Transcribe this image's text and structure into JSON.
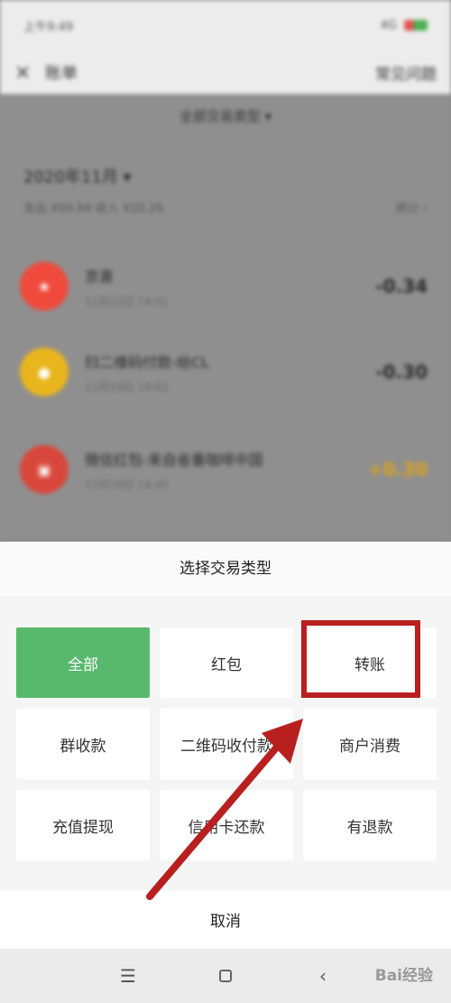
{
  "status_bar": {
    "time": "上午9:49",
    "signal": "4G"
  },
  "nav": {
    "close_icon": "×",
    "title": "账单",
    "help_label": "常见问题"
  },
  "filter": {
    "label": "全部交易类型 ▾"
  },
  "month": {
    "label": "2020年11月 ▾",
    "summary": "支出 ¥99.94 收入 ¥20.26",
    "stats_label": "统计 ›"
  },
  "transactions": [
    {
      "name": "京喜",
      "time": "11月22日 14:01",
      "amount": "-0.34",
      "icon_color": "#f04a3c",
      "icon": "store-icon"
    },
    {
      "name": "扫二维码付款-给CL",
      "time": "11月19日 19:02",
      "amount": "-0.30",
      "icon_color": "#e8b51e",
      "icon": "qr-pay-icon"
    },
    {
      "name": "微信红包-来自省番咖啡中国",
      "time": "11月19日 14:45",
      "amount": "+0.30",
      "icon_color": "#d9473c",
      "icon": "red-packet-icon"
    }
  ],
  "sheet": {
    "title": "选择交易类型",
    "options": [
      "全部",
      "红包",
      "转账",
      "群收款",
      "二维码收付款",
      "商户消费",
      "充值提现",
      "信用卡还款",
      "有退款"
    ],
    "selected": "全部",
    "cancel_label": "取消"
  },
  "system_nav": {
    "menu_icon": "☰",
    "home_icon": "▢",
    "back_icon": "‹"
  },
  "watermark": "Bai经验",
  "colors": {
    "selected_tile": "#58b96d",
    "annotation": "#b8201f",
    "income_amount": "#d9a21c"
  }
}
